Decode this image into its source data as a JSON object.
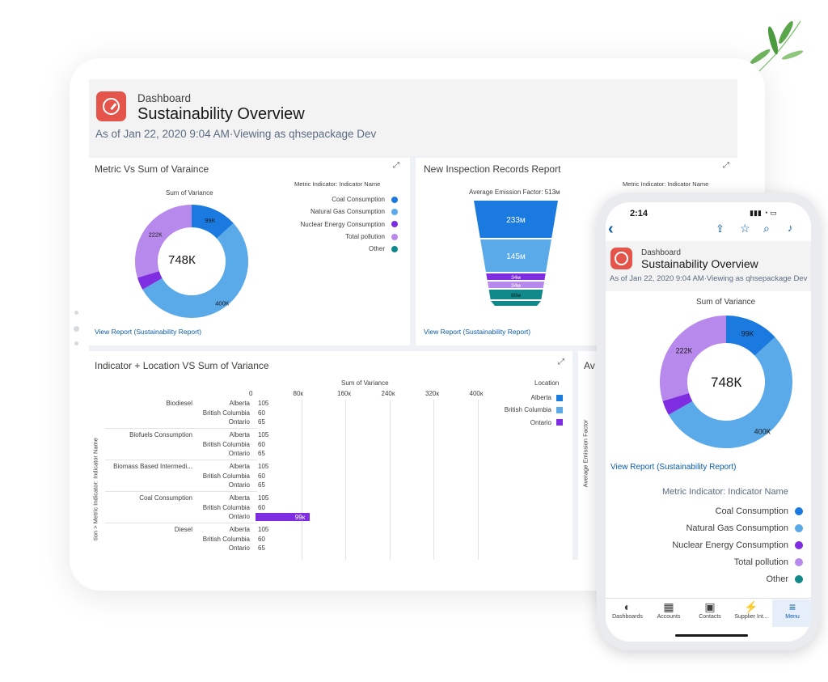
{
  "dashboard": {
    "label": "Dashboard",
    "title": "Sustainability Overview",
    "subtitle": "As of Jan 22, 2020 9:04 AM·Viewing as qhsepackage Dev"
  },
  "card1": {
    "title": "Metric Vs Sum of Varaince",
    "chart_title": "Sum of Variance",
    "center_label": "748К",
    "legend_title": "Metric Indicator: Indicator Name",
    "link": "View Report (Sustainability Report)"
  },
  "card2": {
    "title": "New Inspection Records Report",
    "chart_title": "Average Emission Factor: 513м",
    "legend_title": "Metric Indicator: Indicator Name",
    "link": "View Report (Sustainability Report)"
  },
  "card3": {
    "title": "Indicator + Location VS Sum of Variance",
    "axis_title": "Sum of Variance",
    "legend_title": "Location",
    "y_axis_label": "tion > Metric Indicator: Indicator Name"
  },
  "card4": {
    "title_fragment": "Av",
    "y_axis_label": "Average Emission Factor"
  },
  "phone": {
    "time": "2:14",
    "dashboard_label": "Dashboard",
    "title": "Sustainability Overview",
    "subtitle": "As of Jan 22, 2020 9:04 AM·Viewing as qhsepackage Dev",
    "chart_title": "Sum of Variance",
    "center_label": "748К",
    "link": "View Report (Sustainability Report)",
    "legend_title": "Metric Indicator: Indicator Name",
    "nav": [
      "Dashboards",
      "Accounts",
      "Contacts",
      "Supplier Int...",
      "Menu"
    ]
  },
  "colors": {
    "coal": "#1b7ae0",
    "gas": "#5aa9e8",
    "nuclear": "#7e2ee0",
    "pollution": "#b889ec",
    "other": "#11888a",
    "accent_icon": "#e4544a",
    "link": "#0b5cab"
  },
  "chart_data": [
    {
      "type": "pie",
      "title": "Sum of Variance",
      "center": "748К",
      "legend_title": "Metric Indicator: Indicator Name",
      "slices": [
        {
          "name": "Coal Consumption",
          "value": 99,
          "label": "99К",
          "color": "#1b7ae0"
        },
        {
          "name": "Natural Gas Consumption",
          "value": 400,
          "label": "400К",
          "color": "#5aa9e8"
        },
        {
          "name": "Nuclear Energy Consumption",
          "value": 27,
          "label": "",
          "color": "#7e2ee0"
        },
        {
          "name": "Total pollution",
          "value": 222,
          "label": "222К",
          "color": "#b889ec"
        },
        {
          "name": "Other",
          "value": 0,
          "label": "",
          "color": "#11888a"
        }
      ]
    },
    {
      "type": "bar",
      "subtype": "funnel",
      "title": "Average Emission Factor: 513м",
      "stages": [
        {
          "label": "233м",
          "value": 233,
          "color": "#1b7ae0"
        },
        {
          "label": "145м",
          "value": 145,
          "color": "#5aa9e8"
        },
        {
          "label": "34м",
          "value": 34,
          "color": "#7e2ee0"
        },
        {
          "label": "34м",
          "value": 34,
          "color": "#b889ec"
        },
        {
          "label": "80м",
          "value": 80,
          "color": "#11888a"
        }
      ]
    },
    {
      "type": "bar",
      "orientation": "horizontal",
      "xlabel": "Sum of Variance",
      "ylabel": "tion > Metric Indicator: Indicator Name",
      "ticks": [
        "0",
        "80к",
        "160к",
        "240к",
        "320к",
        "400к"
      ],
      "xlim": [
        0,
        400
      ],
      "legend_title": "Location",
      "legend": [
        {
          "name": "Alberta",
          "color": "#1b7ae0"
        },
        {
          "name": "British Columbia",
          "color": "#5aa9e8"
        },
        {
          "name": "Ontario",
          "color": "#7e2ee0"
        }
      ],
      "groups": [
        {
          "name": "Biodiesel",
          "rows": [
            {
              "location": "Alberta",
              "value": 105,
              "label": "105"
            },
            {
              "location": "British Columbia",
              "value": 60,
              "label": "60"
            },
            {
              "location": "Ontario",
              "value": 65,
              "label": "65"
            }
          ]
        },
        {
          "name": "Biofuels Consumption",
          "rows": [
            {
              "location": "Alberta",
              "value": 105,
              "label": "105"
            },
            {
              "location": "British Columbia",
              "value": 60,
              "label": "60"
            },
            {
              "location": "Ontario",
              "value": 65,
              "label": "65"
            }
          ]
        },
        {
          "name": "Biomass Based Intermedi...",
          "rows": [
            {
              "location": "Alberta",
              "value": 105,
              "label": "105"
            },
            {
              "location": "British Columbia",
              "value": 60,
              "label": "60"
            },
            {
              "location": "Ontario",
              "value": 65,
              "label": "65"
            }
          ]
        },
        {
          "name": "Coal Consumption",
          "rows": [
            {
              "location": "Alberta",
              "value": 105,
              "label": "105"
            },
            {
              "location": "British Columbia",
              "value": 60,
              "label": "60"
            },
            {
              "location": "Ontario",
              "value": 99000,
              "label": "99к"
            }
          ]
        },
        {
          "name": "Diesel",
          "rows": [
            {
              "location": "Alberta",
              "value": 105,
              "label": "105"
            },
            {
              "location": "British Columbia",
              "value": 60,
              "label": "60"
            },
            {
              "location": "Ontario",
              "value": 65,
              "label": "65"
            }
          ]
        }
      ]
    },
    {
      "type": "pie",
      "title": "Sum of Variance",
      "center": "748К",
      "legend_title": "Metric Indicator: Indicator Name",
      "slices": [
        {
          "name": "Coal Consumption",
          "value": 99,
          "label": "99К",
          "color": "#1b7ae0"
        },
        {
          "name": "Natural Gas Consumption",
          "value": 400,
          "label": "400К",
          "color": "#5aa9e8"
        },
        {
          "name": "Nuclear Energy Consumption",
          "value": 27,
          "label": "",
          "color": "#7e2ee0"
        },
        {
          "name": "Total pollution",
          "value": 222,
          "label": "222К",
          "color": "#b889ec"
        },
        {
          "name": "Other",
          "value": 0,
          "label": "",
          "color": "#11888a"
        }
      ]
    }
  ]
}
